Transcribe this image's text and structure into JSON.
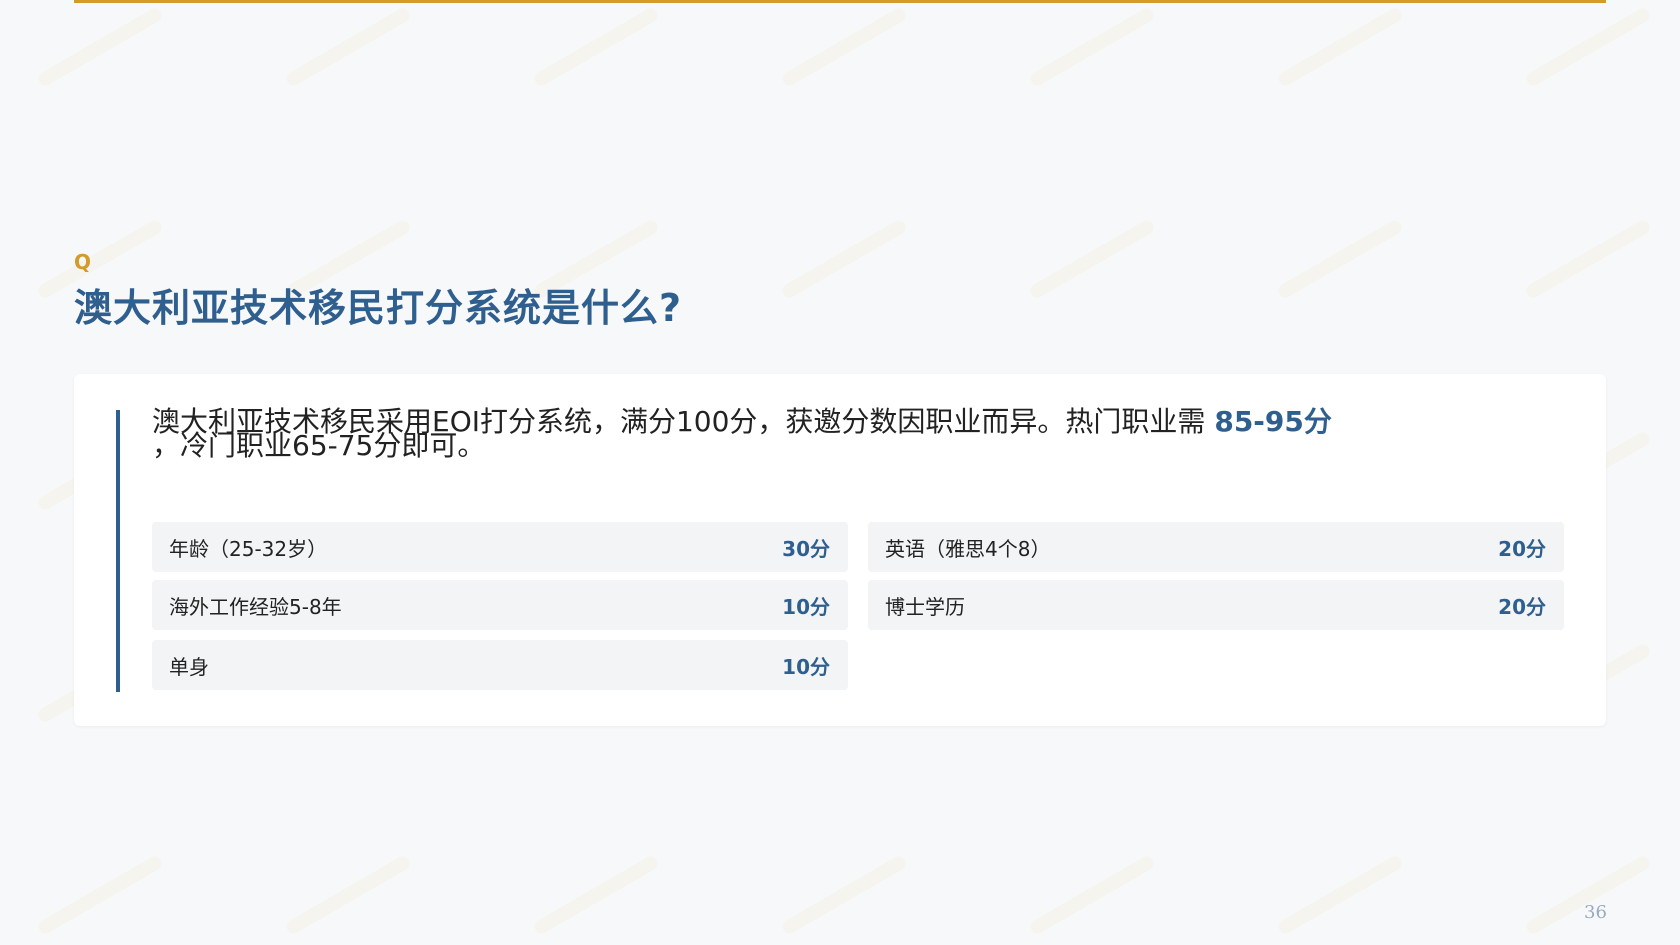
{
  "colors": {
    "accent_gold": "#d49a2a",
    "primary_blue": "#2f5f8e",
    "card_bg": "#ffffff",
    "row_bg": "#f3f4f6",
    "page_bg": "#f7f8fa"
  },
  "header": {
    "q_label": "Q",
    "title": "澳大利亚技术移民打分系统是什么?"
  },
  "answer": {
    "intro_text": "澳大利亚技术移民采用EOI打分系统，满分100分，获邀分数因职业而异。热门职业需",
    "intro_highlight": "85-95分",
    "intro_tail": "，冷门职业65-75分即可。"
  },
  "score_items": [
    {
      "label": "年龄（25-32岁）",
      "value": "30分"
    },
    {
      "label": "英语（雅思4个8）",
      "value": "20分"
    },
    {
      "label": "海外工作经验5-8年",
      "value": "10分"
    },
    {
      "label": "博士学历",
      "value": "20分"
    },
    {
      "label": "单身",
      "value": "10分"
    }
  ],
  "page_number": "36"
}
